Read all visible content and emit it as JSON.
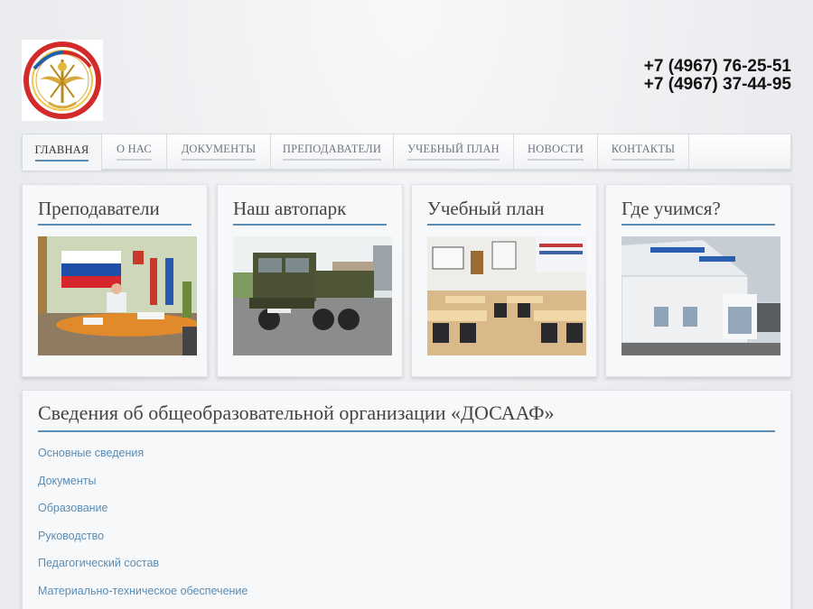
{
  "header": {
    "phones": [
      "+7 (4967) 76-25-51",
      "+7 (4967) 37-44-95"
    ],
    "logo_icon": "dosaaf-emblem-icon"
  },
  "nav": {
    "items": [
      {
        "label": "ГЛАВНАЯ",
        "active": true
      },
      {
        "label": "О НАС"
      },
      {
        "label": "ДОКУМЕНТЫ"
      },
      {
        "label": "ПРЕПОДАВАТЕЛИ"
      },
      {
        "label": "УЧЕБНЫЙ ПЛАН"
      },
      {
        "label": "НОВОСТИ"
      },
      {
        "label": "КОНТАКТЫ"
      }
    ]
  },
  "cards": [
    {
      "title": "Преподаватели",
      "image": "office-with-flag-photo"
    },
    {
      "title": "Наш автопарк",
      "image": "military-truck-photo"
    },
    {
      "title": "Учебный план",
      "image": "classroom-photo"
    },
    {
      "title": "Где учимся?",
      "image": "dosaaf-building-photo"
    }
  ],
  "info": {
    "title": "Сведения об общеобразовательной организации «ДОСААФ»",
    "links": [
      "Основные сведения",
      "Документы",
      "Образование",
      "Руководство",
      "Педагогический состав",
      "Материально-техническое обеспечение"
    ]
  },
  "colors": {
    "accent": "#5b8db5",
    "background": "#eceef0",
    "card": "#f7f8f9"
  }
}
